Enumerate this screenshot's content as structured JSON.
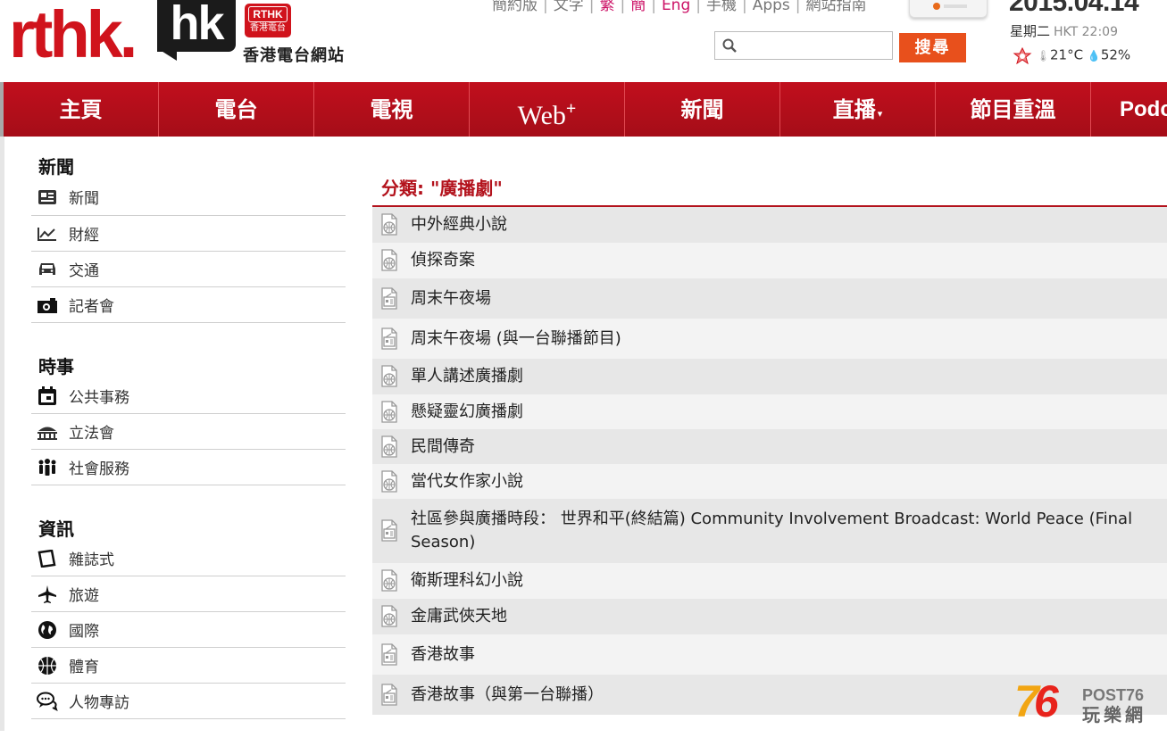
{
  "header": {
    "logo_text": "rthk.",
    "logo_hk": "hk",
    "badge_top": "RTHK",
    "badge_bottom": "香港電台",
    "site_name": "香港電台網站",
    "top_links": [
      "簡約版",
      "文字",
      "繁",
      "簡",
      "Eng",
      "手機",
      "Apps",
      "網站指南"
    ],
    "date": "2015.04.14",
    "weekday": "星期二",
    "time": "HKT 22:09",
    "temperature": "21°C",
    "humidity": "52%",
    "search_placeholder": "",
    "search_button": "搜尋"
  },
  "nav": {
    "items": [
      "主頁",
      "電台",
      "電視",
      "Web",
      "新聞",
      "直播",
      "節目重溫",
      "Podc"
    ],
    "web_plus": "+",
    "caret": "▾"
  },
  "sidebar": {
    "sections": [
      {
        "title": "新聞",
        "items": [
          {
            "label": "新聞",
            "icon": "newspaper-icon"
          },
          {
            "label": "財經",
            "icon": "line-chart-icon"
          },
          {
            "label": "交通",
            "icon": "car-icon"
          },
          {
            "label": "記者會",
            "icon": "camera-icon"
          }
        ]
      },
      {
        "title": "時事",
        "items": [
          {
            "label": "公共事務",
            "icon": "calendar-icon"
          },
          {
            "label": "立法會",
            "icon": "legislature-building-icon"
          },
          {
            "label": "社會服務",
            "icon": "people-group-icon"
          }
        ]
      },
      {
        "title": "資訊",
        "items": [
          {
            "label": "雜誌式",
            "icon": "magazine-icon"
          },
          {
            "label": "旅遊",
            "icon": "airplane-icon"
          },
          {
            "label": "國際",
            "icon": "globe-icon"
          },
          {
            "label": "體育",
            "icon": "basketball-icon"
          },
          {
            "label": "人物專訪",
            "icon": "chat-bubbles-icon"
          }
        ]
      }
    ]
  },
  "main": {
    "category_title": "分類: \"廣播劇\"",
    "programs": [
      {
        "title": "中外經典小說",
        "icon": "archive-icon"
      },
      {
        "title": "偵探奇案",
        "icon": "archive-icon"
      },
      {
        "title": "周末午夜場",
        "icon": "radio-icon"
      },
      {
        "title": "周末午夜場 (與一台聯播節目)",
        "icon": "radio-icon"
      },
      {
        "title": "單人講述廣播劇",
        "icon": "archive-icon"
      },
      {
        "title": "懸疑靈幻廣播劇",
        "icon": "archive-icon"
      },
      {
        "title": "民間傳奇",
        "icon": "archive-icon"
      },
      {
        "title": "當代女作家小說",
        "icon": "archive-icon"
      },
      {
        "title": "社區參與廣播時段： 世界和平(終結篇) Community Involvement Broadcast: World Peace (Final Season)",
        "icon": "radio-icon"
      },
      {
        "title": "衛斯理科幻小說",
        "icon": "archive-icon"
      },
      {
        "title": "金庸武俠天地",
        "icon": "archive-icon"
      },
      {
        "title": "香港故事",
        "icon": "radio-icon"
      },
      {
        "title": "香港故事（與第一台聯播）",
        "icon": "radio-icon"
      }
    ]
  },
  "watermark": {
    "number_a": "7",
    "number_b": "6",
    "brand": "POST76",
    "brand_cn": "玩樂網"
  },
  "colors": {
    "brand_red": "#d0131c",
    "nav_red": "#b80f1b",
    "search_orange": "#e8501c",
    "category_red": "#b3121c"
  }
}
